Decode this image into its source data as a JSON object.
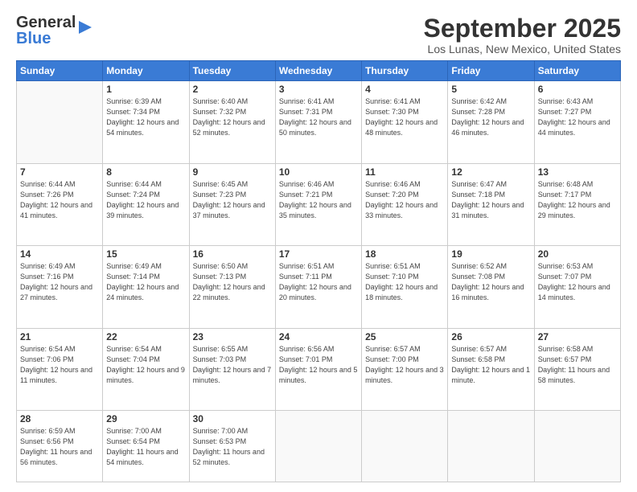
{
  "header": {
    "logo_general": "General",
    "logo_blue": "Blue",
    "title": "September 2025",
    "subtitle": "Los Lunas, New Mexico, United States"
  },
  "days_of_week": [
    "Sunday",
    "Monday",
    "Tuesday",
    "Wednesday",
    "Thursday",
    "Friday",
    "Saturday"
  ],
  "weeks": [
    [
      {
        "day": "",
        "sunrise": "",
        "sunset": "",
        "daylight": ""
      },
      {
        "day": "1",
        "sunrise": "Sunrise: 6:39 AM",
        "sunset": "Sunset: 7:34 PM",
        "daylight": "Daylight: 12 hours and 54 minutes."
      },
      {
        "day": "2",
        "sunrise": "Sunrise: 6:40 AM",
        "sunset": "Sunset: 7:32 PM",
        "daylight": "Daylight: 12 hours and 52 minutes."
      },
      {
        "day": "3",
        "sunrise": "Sunrise: 6:41 AM",
        "sunset": "Sunset: 7:31 PM",
        "daylight": "Daylight: 12 hours and 50 minutes."
      },
      {
        "day": "4",
        "sunrise": "Sunrise: 6:41 AM",
        "sunset": "Sunset: 7:30 PM",
        "daylight": "Daylight: 12 hours and 48 minutes."
      },
      {
        "day": "5",
        "sunrise": "Sunrise: 6:42 AM",
        "sunset": "Sunset: 7:28 PM",
        "daylight": "Daylight: 12 hours and 46 minutes."
      },
      {
        "day": "6",
        "sunrise": "Sunrise: 6:43 AM",
        "sunset": "Sunset: 7:27 PM",
        "daylight": "Daylight: 12 hours and 44 minutes."
      }
    ],
    [
      {
        "day": "7",
        "sunrise": "Sunrise: 6:44 AM",
        "sunset": "Sunset: 7:26 PM",
        "daylight": "Daylight: 12 hours and 41 minutes."
      },
      {
        "day": "8",
        "sunrise": "Sunrise: 6:44 AM",
        "sunset": "Sunset: 7:24 PM",
        "daylight": "Daylight: 12 hours and 39 minutes."
      },
      {
        "day": "9",
        "sunrise": "Sunrise: 6:45 AM",
        "sunset": "Sunset: 7:23 PM",
        "daylight": "Daylight: 12 hours and 37 minutes."
      },
      {
        "day": "10",
        "sunrise": "Sunrise: 6:46 AM",
        "sunset": "Sunset: 7:21 PM",
        "daylight": "Daylight: 12 hours and 35 minutes."
      },
      {
        "day": "11",
        "sunrise": "Sunrise: 6:46 AM",
        "sunset": "Sunset: 7:20 PM",
        "daylight": "Daylight: 12 hours and 33 minutes."
      },
      {
        "day": "12",
        "sunrise": "Sunrise: 6:47 AM",
        "sunset": "Sunset: 7:18 PM",
        "daylight": "Daylight: 12 hours and 31 minutes."
      },
      {
        "day": "13",
        "sunrise": "Sunrise: 6:48 AM",
        "sunset": "Sunset: 7:17 PM",
        "daylight": "Daylight: 12 hours and 29 minutes."
      }
    ],
    [
      {
        "day": "14",
        "sunrise": "Sunrise: 6:49 AM",
        "sunset": "Sunset: 7:16 PM",
        "daylight": "Daylight: 12 hours and 27 minutes."
      },
      {
        "day": "15",
        "sunrise": "Sunrise: 6:49 AM",
        "sunset": "Sunset: 7:14 PM",
        "daylight": "Daylight: 12 hours and 24 minutes."
      },
      {
        "day": "16",
        "sunrise": "Sunrise: 6:50 AM",
        "sunset": "Sunset: 7:13 PM",
        "daylight": "Daylight: 12 hours and 22 minutes."
      },
      {
        "day": "17",
        "sunrise": "Sunrise: 6:51 AM",
        "sunset": "Sunset: 7:11 PM",
        "daylight": "Daylight: 12 hours and 20 minutes."
      },
      {
        "day": "18",
        "sunrise": "Sunrise: 6:51 AM",
        "sunset": "Sunset: 7:10 PM",
        "daylight": "Daylight: 12 hours and 18 minutes."
      },
      {
        "day": "19",
        "sunrise": "Sunrise: 6:52 AM",
        "sunset": "Sunset: 7:08 PM",
        "daylight": "Daylight: 12 hours and 16 minutes."
      },
      {
        "day": "20",
        "sunrise": "Sunrise: 6:53 AM",
        "sunset": "Sunset: 7:07 PM",
        "daylight": "Daylight: 12 hours and 14 minutes."
      }
    ],
    [
      {
        "day": "21",
        "sunrise": "Sunrise: 6:54 AM",
        "sunset": "Sunset: 7:06 PM",
        "daylight": "Daylight: 12 hours and 11 minutes."
      },
      {
        "day": "22",
        "sunrise": "Sunrise: 6:54 AM",
        "sunset": "Sunset: 7:04 PM",
        "daylight": "Daylight: 12 hours and 9 minutes."
      },
      {
        "day": "23",
        "sunrise": "Sunrise: 6:55 AM",
        "sunset": "Sunset: 7:03 PM",
        "daylight": "Daylight: 12 hours and 7 minutes."
      },
      {
        "day": "24",
        "sunrise": "Sunrise: 6:56 AM",
        "sunset": "Sunset: 7:01 PM",
        "daylight": "Daylight: 12 hours and 5 minutes."
      },
      {
        "day": "25",
        "sunrise": "Sunrise: 6:57 AM",
        "sunset": "Sunset: 7:00 PM",
        "daylight": "Daylight: 12 hours and 3 minutes."
      },
      {
        "day": "26",
        "sunrise": "Sunrise: 6:57 AM",
        "sunset": "Sunset: 6:58 PM",
        "daylight": "Daylight: 12 hours and 1 minute."
      },
      {
        "day": "27",
        "sunrise": "Sunrise: 6:58 AM",
        "sunset": "Sunset: 6:57 PM",
        "daylight": "Daylight: 11 hours and 58 minutes."
      }
    ],
    [
      {
        "day": "28",
        "sunrise": "Sunrise: 6:59 AM",
        "sunset": "Sunset: 6:56 PM",
        "daylight": "Daylight: 11 hours and 56 minutes."
      },
      {
        "day": "29",
        "sunrise": "Sunrise: 7:00 AM",
        "sunset": "Sunset: 6:54 PM",
        "daylight": "Daylight: 11 hours and 54 minutes."
      },
      {
        "day": "30",
        "sunrise": "Sunrise: 7:00 AM",
        "sunset": "Sunset: 6:53 PM",
        "daylight": "Daylight: 11 hours and 52 minutes."
      },
      {
        "day": "",
        "sunrise": "",
        "sunset": "",
        "daylight": ""
      },
      {
        "day": "",
        "sunrise": "",
        "sunset": "",
        "daylight": ""
      },
      {
        "day": "",
        "sunrise": "",
        "sunset": "",
        "daylight": ""
      },
      {
        "day": "",
        "sunrise": "",
        "sunset": "",
        "daylight": ""
      }
    ]
  ]
}
